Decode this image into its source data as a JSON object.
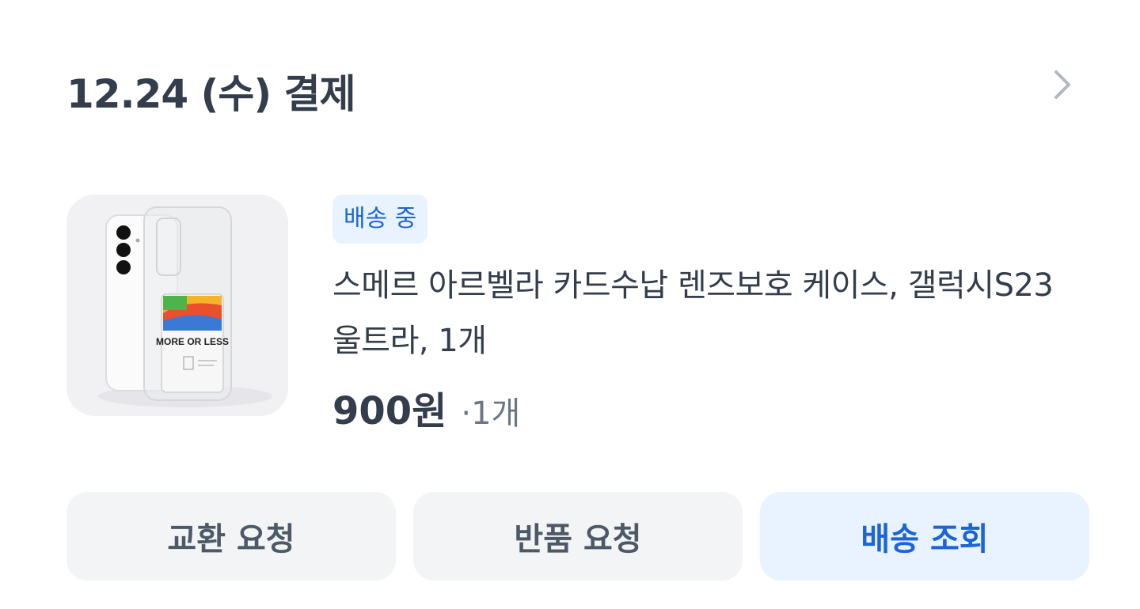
{
  "order": {
    "date_title": "12.24 (수) 결제"
  },
  "product": {
    "status_badge": "배송 중",
    "name": "스메르 아르벨라 카드수납 렌즈보호 케이스, 갤럭시S23 울트라, 1개",
    "price": "900원",
    "quantity": "·1개",
    "image_label": "MORE OR LESS"
  },
  "actions": {
    "exchange_label": "교환 요청",
    "return_label": "반품 요청",
    "track_label": "배송 조회"
  },
  "colors": {
    "accent": "#1b64da",
    "accent_bg": "#e8f3ff",
    "button_bg": "#f2f4f6",
    "text_primary": "#333d4b",
    "text_secondary": "#6b7684"
  },
  "icons": {
    "chevron": "chevron-right-icon"
  }
}
